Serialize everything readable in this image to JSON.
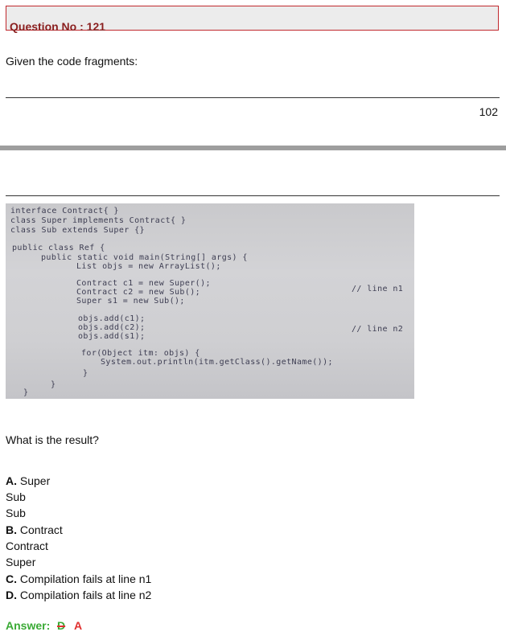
{
  "question": {
    "title": "Question No : 121",
    "prompt": "Given the code fragments:"
  },
  "page_number": "102",
  "code_image": {
    "lines": [
      "interface Contract{ }",
      "class Super implements Contract{ }",
      "class Sub extends Super {}",
      "public class Ref {",
      "public static void main(String[] args) {",
      "List objs = new ArrayList();",
      "Contract c1 = new Super();",
      "Contract c2 = new Sub();",
      "Super s1 = new Sub();",
      "objs.add(c1);",
      "objs.add(c2);",
      "objs.add(s1);",
      "for(Object itm: objs) {",
      "System.out.println(itm.getClass().getName());",
      "}",
      "}",
      "}"
    ],
    "comments": {
      "n1": "// line n1",
      "n2": "// line n2"
    }
  },
  "question_text": "What is the result?",
  "options": {
    "a": {
      "letter": "A.",
      "lines": [
        "Super",
        "Sub",
        "Sub"
      ]
    },
    "b": {
      "letter": "B.",
      "lines": [
        "Contract",
        "Contract",
        "Super"
      ]
    },
    "c": {
      "letter": "C.",
      "text": "Compilation fails at line n1"
    },
    "d": {
      "letter": "D.",
      "text": "Compilation fails at line n2"
    }
  },
  "answer": {
    "label": "Answer:",
    "struck": "D",
    "correct": "A"
  },
  "colors": {
    "title": "#8a1f1f",
    "title_border": "#c0282d",
    "answer_label": "#3aaa35",
    "answer_correct": "#e0302f"
  }
}
